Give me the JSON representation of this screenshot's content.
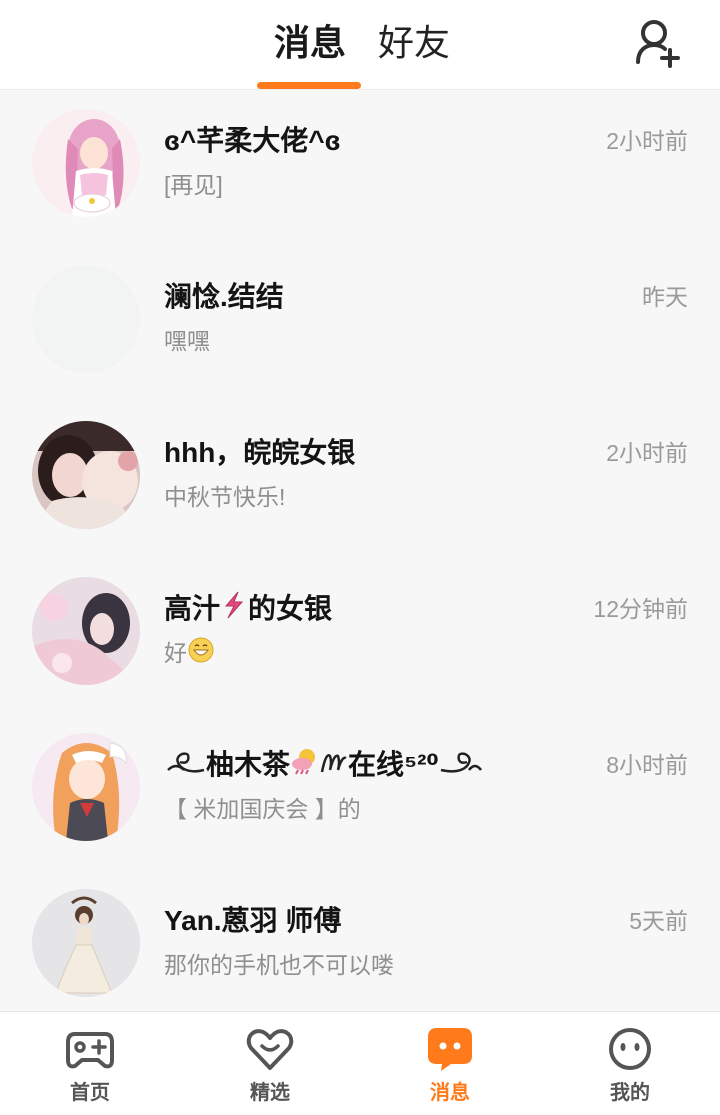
{
  "header": {
    "tabs": [
      {
        "label": "消息",
        "active": true
      },
      {
        "label": "好友",
        "active": false
      }
    ],
    "add_friend_icon": "add-person-icon",
    "accent_color": "#ff7a1a"
  },
  "conversations": [
    {
      "name": "ɞ^芊柔大佬^ɞ",
      "preview": "[再见]",
      "time": "2小时前",
      "avatar": "anime-pink-hair-avatar"
    },
    {
      "name": "澜惗.结结",
      "preview": "嘿嘿",
      "time": "昨天",
      "avatar": "blank-avatar"
    },
    {
      "name": "hhh，皖皖女银",
      "preview": "中秋节快乐!",
      "time": "2小时前",
      "avatar": "photo-girl-avatar"
    },
    {
      "name_parts": [
        "高汁",
        "的女银"
      ],
      "name_icon": "lightning-sticker",
      "preview": "好",
      "preview_icon": "grin-emoji",
      "time": "12分钟前",
      "avatar": "photo-girl-pink-avatar"
    },
    {
      "name_parts": [
        "柚木茶",
        "在线⁵²⁰"
      ],
      "name_icons": [
        "swirl-left-ornament",
        "sun-cloud-sticker",
        "script-m-glyph",
        "swirl-right-ornament"
      ],
      "preview": "【 米加国庆会 】的",
      "time": "8小时前",
      "avatar": "anime-orange-hair-avatar"
    },
    {
      "name": "Yan.蒽羽 师傅",
      "preview": "那你的手机也不可以喽",
      "time": "5天前",
      "avatar": "figure-white-dress-avatar"
    }
  ],
  "bottom_nav": [
    {
      "label": "首页",
      "icon": "gamepad-icon",
      "active": false
    },
    {
      "label": "精选",
      "icon": "heart-icon",
      "active": false
    },
    {
      "label": "消息",
      "icon": "chat-bubble-icon",
      "active": true
    },
    {
      "label": "我的",
      "icon": "face-icon",
      "active": false
    }
  ]
}
